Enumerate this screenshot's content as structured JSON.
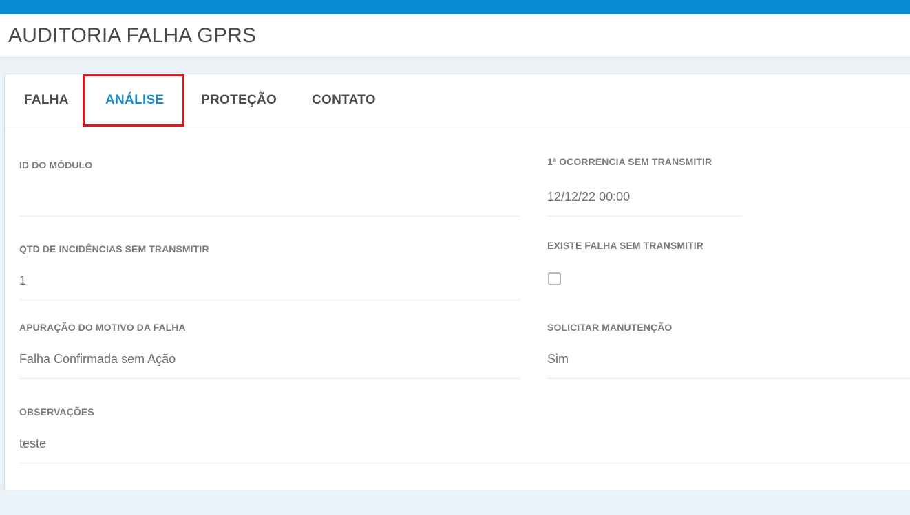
{
  "page": {
    "title": "AUDITORIA FALHA GPRS"
  },
  "tabs": [
    {
      "label": "FALHA"
    },
    {
      "label": "ANÁLISE"
    },
    {
      "label": "PROTEÇÃO"
    },
    {
      "label": "CONTATO"
    }
  ],
  "fields": {
    "id_modulo": {
      "label": "ID DO MÓDULO",
      "value": ""
    },
    "primeira_ocorrencia": {
      "label": "1ª OCORRENCIA SEM TRANSMITIR",
      "value": "12/12/22 00:00"
    },
    "qtd_incidencias": {
      "label": "QTD DE INCIDÊNCIAS SEM TRANSMITIR",
      "value": "1"
    },
    "existe_falha": {
      "label": "EXISTE FALHA SEM TRANSMITIR",
      "checked": false
    },
    "apuracao": {
      "label": "APURAÇÃO DO MOTIVO DA FALHA",
      "value": "Falha Confirmada sem Ação"
    },
    "solicitar_manutencao": {
      "label": "SOLICITAR MANUTENÇÃO",
      "value": "Sim"
    },
    "observacoes": {
      "label": "OBSERVAÇÕES",
      "value": "teste"
    }
  },
  "colors": {
    "accent": "#0a8ad0",
    "active_tab": "#1a8bcf",
    "highlight": "#e8151b"
  }
}
